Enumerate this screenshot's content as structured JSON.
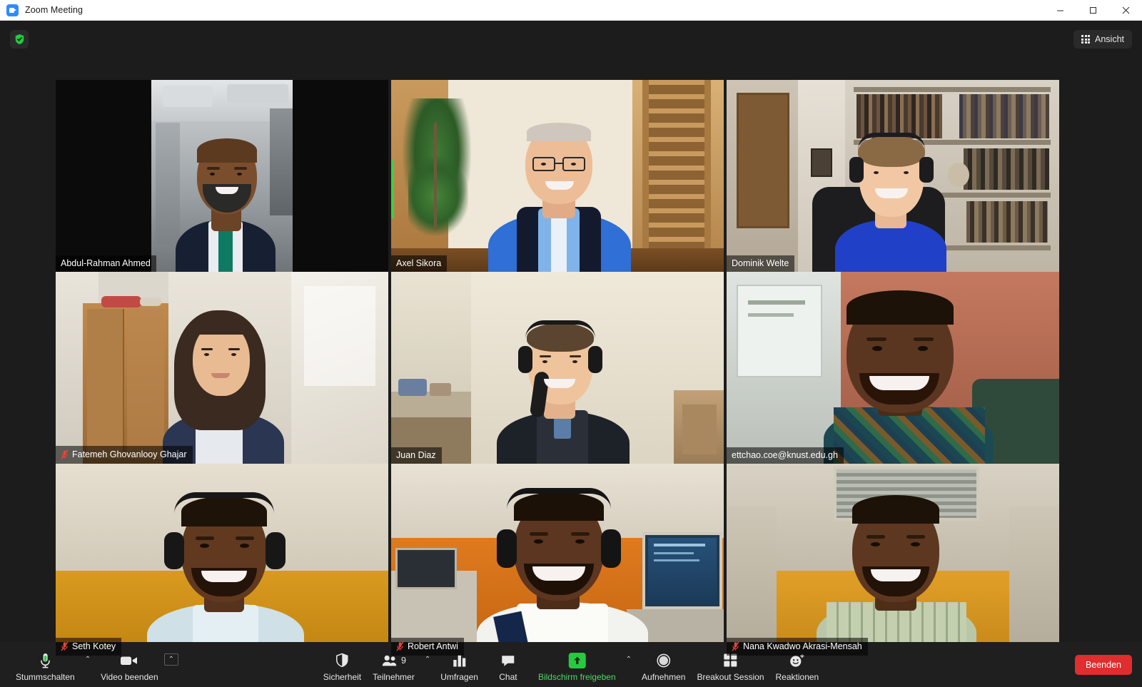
{
  "window": {
    "title": "Zoom Meeting",
    "logo_icon": "zoom-logo-icon",
    "minimize_label": "−",
    "maximize_label": "□",
    "close_label": "✕"
  },
  "stage": {
    "encryption_icon": "shield-check-icon",
    "view_button": {
      "label": "Ansicht",
      "icon": "grid-view-icon"
    }
  },
  "participants": [
    {
      "name": "Abdul-Rahman Ahmed",
      "muted": false,
      "active_speaker": false
    },
    {
      "name": "Axel Sikora",
      "muted": false,
      "active_speaker": true
    },
    {
      "name": "Dominik Welte",
      "muted": false,
      "active_speaker": false
    },
    {
      "name": "Fatemeh Ghovanlooy Ghajar",
      "muted": true,
      "active_speaker": false
    },
    {
      "name": "Juan Diaz",
      "muted": false,
      "active_speaker": false
    },
    {
      "name": "ettchao.coe@knust.edu.gh",
      "muted": false,
      "active_speaker": false
    },
    {
      "name": "Seth Kotey",
      "muted": true,
      "active_speaker": false
    },
    {
      "name": "Robert Antwi",
      "muted": true,
      "active_speaker": false
    },
    {
      "name": "Nana Kwadwo Akrasi-Mensah",
      "muted": true,
      "active_speaker": false
    }
  ],
  "toolbar": {
    "mute": {
      "label": "Stummschalten",
      "icon": "microphone-icon",
      "caret": "⌃"
    },
    "video": {
      "label": "Video beenden",
      "icon": "video-camera-icon",
      "caret": "⌃"
    },
    "security": {
      "label": "Sicherheit",
      "icon": "shield-icon"
    },
    "participants": {
      "label": "Teilnehmer",
      "icon": "people-icon",
      "count": "9",
      "caret": "⌃"
    },
    "polls": {
      "label": "Umfragen",
      "icon": "bar-chart-icon"
    },
    "chat": {
      "label": "Chat",
      "icon": "speech-bubble-icon"
    },
    "share": {
      "label": "Bildschirm freigeben",
      "icon": "share-screen-icon",
      "caret": "⌃"
    },
    "record": {
      "label": "Aufnehmen",
      "icon": "record-circle-icon"
    },
    "breakout": {
      "label": "Breakout Session",
      "icon": "breakout-rooms-icon"
    },
    "reactions": {
      "label": "Reaktionen",
      "icon": "smiley-plus-icon"
    },
    "end": {
      "label": "Beenden"
    }
  },
  "colors": {
    "accent_blue": "#2d8cff",
    "active_speaker_border": "#f2e85c",
    "audio_level_green": "#35d442",
    "share_green": "#4ed964",
    "end_red": "#e02d2d",
    "muted_red": "#e8443a",
    "stage_bg": "#1c1c1c",
    "toolbar_bg": "#1f1f1f"
  }
}
